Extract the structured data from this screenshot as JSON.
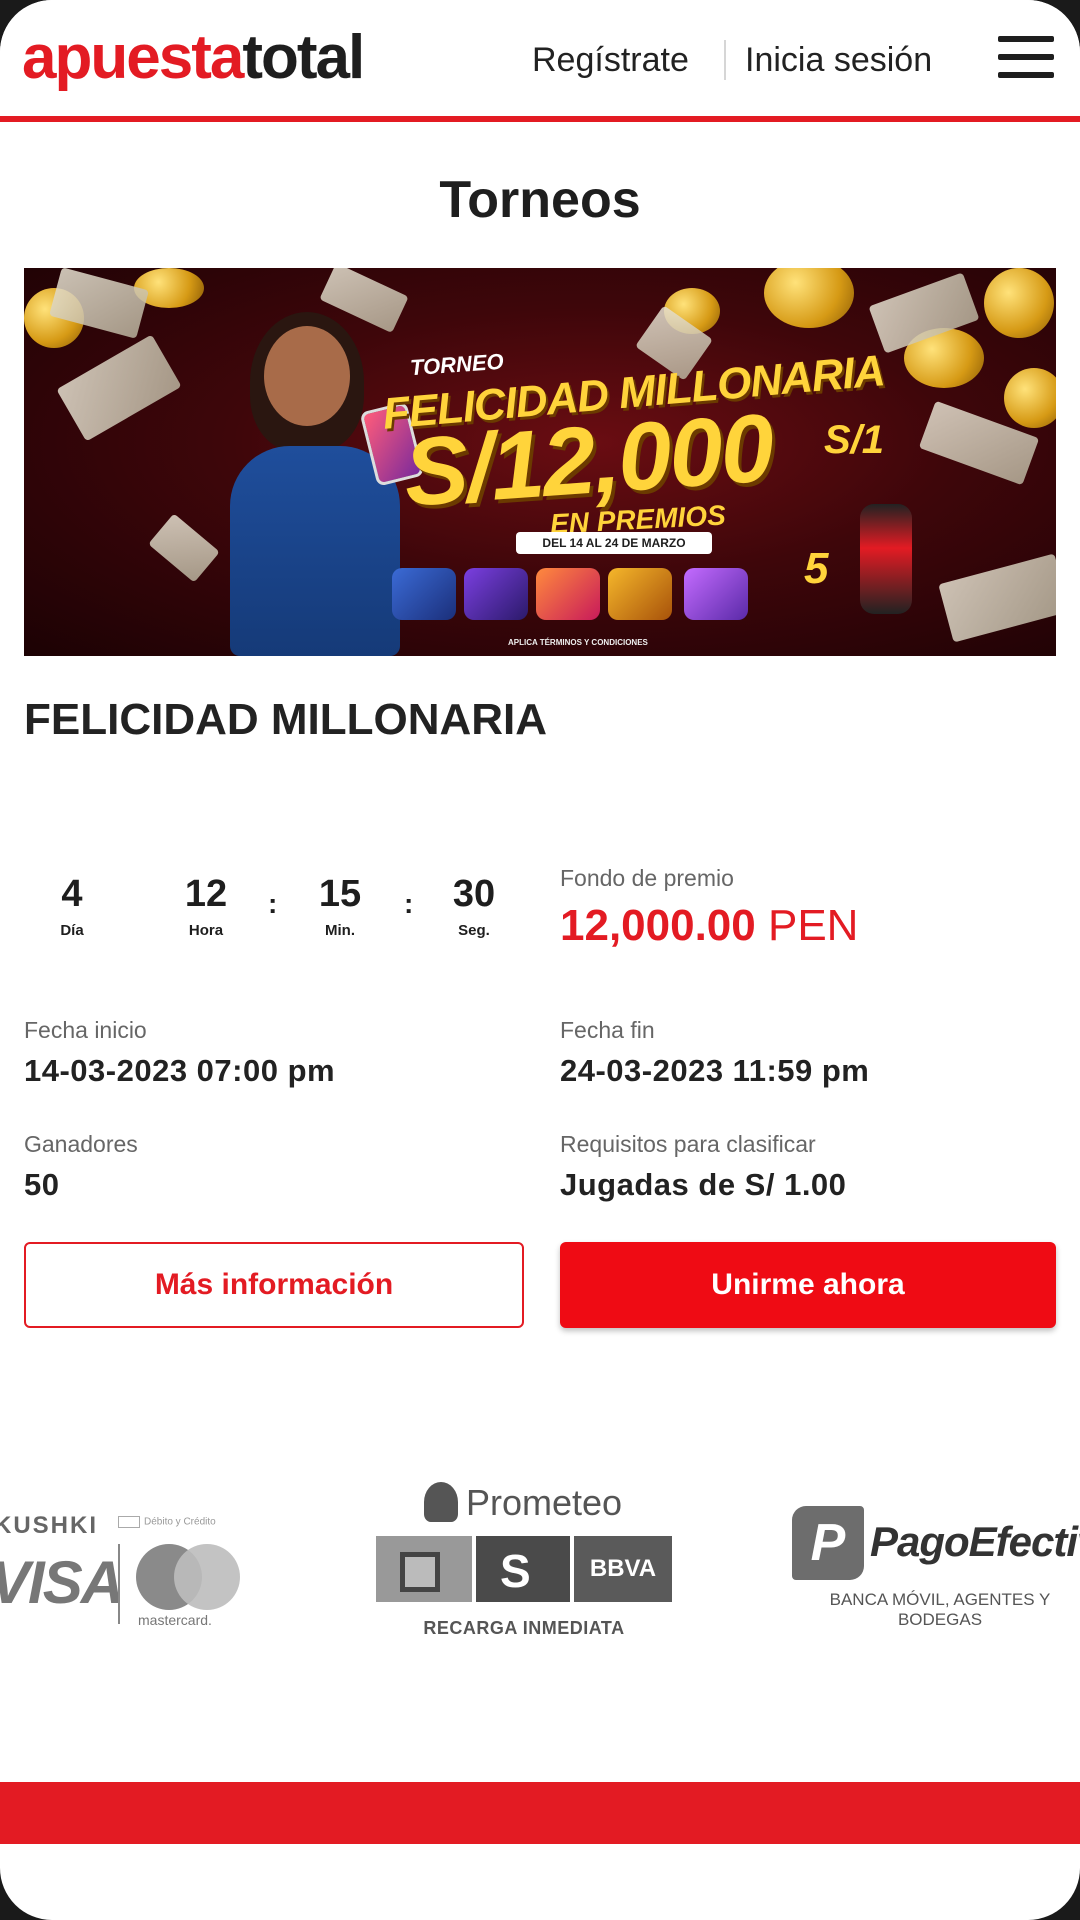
{
  "header": {
    "logo_part1": "apuesta",
    "logo_part2": "total",
    "register": "Regístrate",
    "login": "Inicia sesión"
  },
  "page": {
    "title": "Torneos"
  },
  "banner": {
    "torneo": "TORNEO",
    "name": "FELICIDAD MILLONARIA",
    "amount": "S/12,000",
    "premios": "EN PREMIOS",
    "dates": "DEL 14 AL 24 DE MARZO",
    "apuesta": "S/1",
    "sorteo": "5",
    "terms": "APLICA TÉRMINOS Y CONDICIONES"
  },
  "tournament": {
    "name": "FELICIDAD MILLONARIA",
    "countdown": {
      "days": "4",
      "days_label": "Día",
      "hours": "12",
      "hours_label": "Hora",
      "minutes": "15",
      "minutes_label": "Min.",
      "seconds": "30",
      "seconds_label": "Seg.",
      "separator": ":"
    },
    "prize_label": "Fondo de premio",
    "prize_value": "12,000.00",
    "prize_currency": "PEN",
    "start_label": "Fecha inicio",
    "start_value": "14-03-2023 07:00 pm",
    "end_label": "Fecha fin",
    "end_value": "24-03-2023 11:59 pm",
    "winners_label": "Ganadores",
    "winners_value": "50",
    "req_label": "Requisitos para clasificar",
    "req_value": "Jugadas de S/ 1.00",
    "more_info": "Más información",
    "join_now": "Unirme ahora"
  },
  "payments": {
    "kushki": "KUSHKI",
    "kushki_card": "Débito y Crédito",
    "visa": "VISA",
    "mastercard": "mastercard.",
    "prometeo": "Prometeo",
    "bbva": "BBVA",
    "recarga": "RECARGA INMEDIATA",
    "pagoefectivo": "PagoEfectivo",
    "pagoefectivo_sub": "BANCA MÓVIL, AGENTES Y BODEGAS"
  },
  "colors": {
    "brand_red": "#e31b23",
    "button_red": "#ef0b14"
  }
}
